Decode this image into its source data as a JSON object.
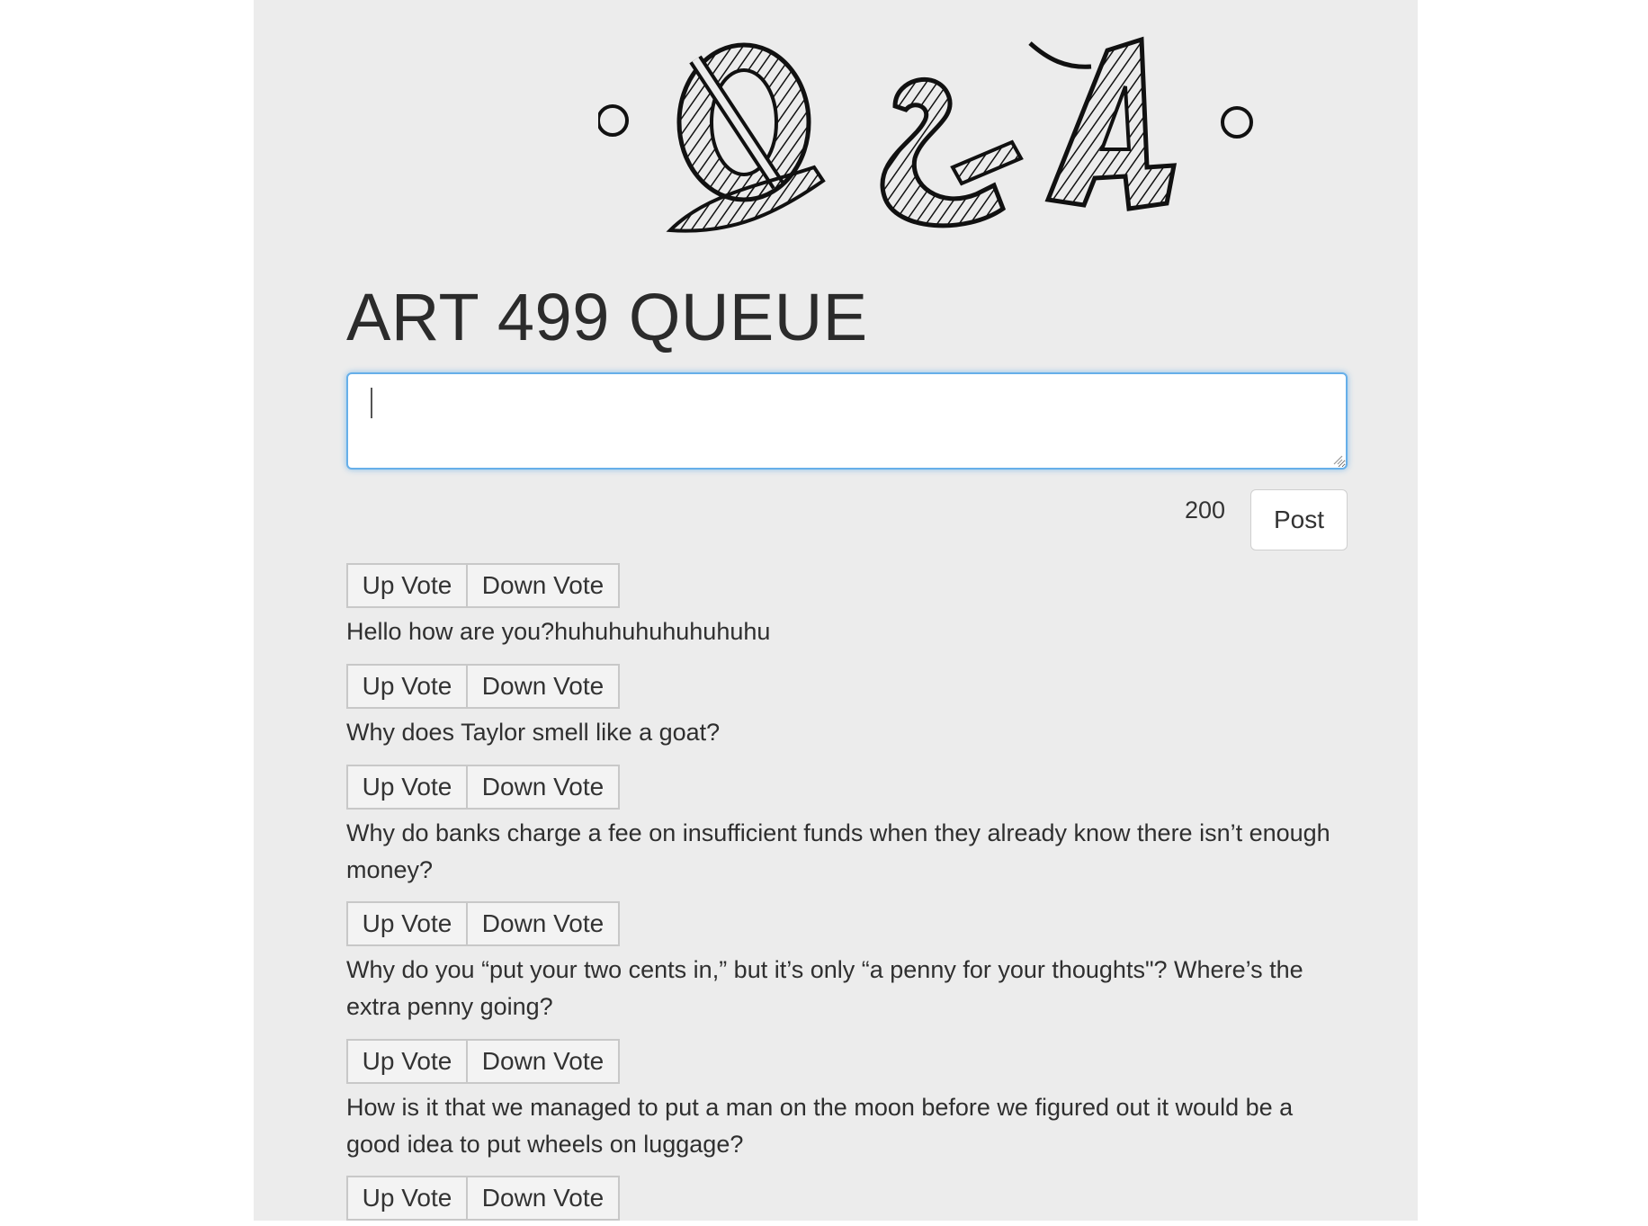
{
  "logo": {
    "text": "Q&A"
  },
  "page": {
    "title": "ART 499 QUEUE"
  },
  "composer": {
    "input_value": "",
    "input_placeholder": "",
    "char_count": "200",
    "post_label": "Post"
  },
  "vote": {
    "up_label": "Up Vote",
    "down_label": "Down Vote"
  },
  "questions": [
    {
      "text": "Hello how are you?huhuhuhuhuhuhuhu"
    },
    {
      "text": "Why does Taylor smell like a goat?"
    },
    {
      "text": "Why do banks charge a fee on insufficient funds when they already know there isn’t enough money?"
    },
    {
      "text": "Why do you “put your two cents in,” but it’s only “a penny for your thoughts\"? Where’s the extra penny going?"
    },
    {
      "text": "How is it that we managed to put a man on the moon before we figured out it would be a good idea to put wheels on luggage?"
    },
    {
      "text": ""
    }
  ],
  "colors": {
    "panel_bg": "#ececec",
    "focus_ring": "#66afe9",
    "text": "#2f2f2f"
  }
}
